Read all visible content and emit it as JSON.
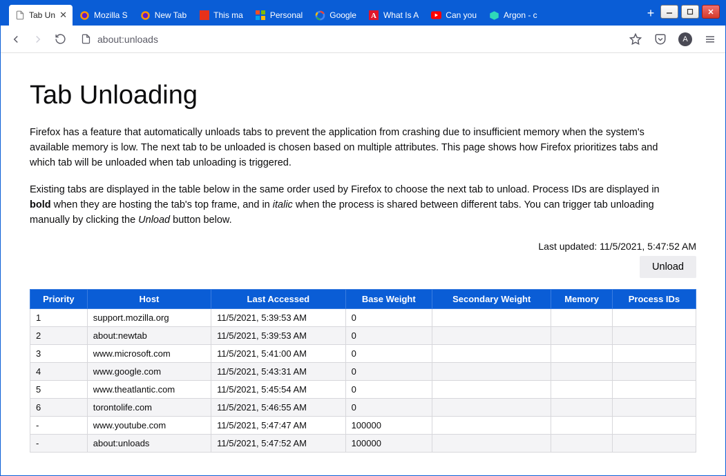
{
  "tabs": [
    {
      "label": "Tab Unloa",
      "icon": "blank",
      "active": true
    },
    {
      "label": "Mozilla S",
      "icon": "firefox"
    },
    {
      "label": "New Tab",
      "icon": "firefox"
    },
    {
      "label": "This ma",
      "icon": "microsoft-red"
    },
    {
      "label": "Personal",
      "icon": "microsoft"
    },
    {
      "label": "Google",
      "icon": "google"
    },
    {
      "label": "What Is A",
      "icon": "atlantic"
    },
    {
      "label": "Can you",
      "icon": "youtube"
    },
    {
      "label": "Argon - c",
      "icon": "argon"
    }
  ],
  "newtab_glyph": "+",
  "winctrl": {
    "min": "−",
    "max": "□",
    "close": "✕"
  },
  "url": "about:unloads",
  "avatar_letter": "A",
  "page": {
    "title": "Tab Unloading",
    "para1_a": "Firefox has a feature that automatically unloads tabs to prevent the application from crashing due to insufficient memory when the system's available memory is low. The next tab to be unloaded is chosen based on multiple attributes. This page shows how Firefox prioritizes tabs and which tab will be unloaded when tab unloading is triggered.",
    "para2_a": "Existing tabs are displayed in the table below in the same order used by Firefox to choose the next tab to unload. Process IDs are displayed in ",
    "para2_bold": "bold",
    "para2_b": " when they are hosting the tab's top frame, and in ",
    "para2_italic": "italic",
    "para2_c": " when the process is shared between different tabs. You can trigger tab unloading manually by clicking the ",
    "para2_unload_word": "Unload",
    "para2_d": " button below.",
    "last_updated_label": "Last updated: ",
    "last_updated_value": "11/5/2021, 5:47:52 AM",
    "unload_button": "Unload"
  },
  "table": {
    "headers": [
      "Priority",
      "Host",
      "Last Accessed",
      "Base Weight",
      "Secondary Weight",
      "Memory",
      "Process IDs"
    ],
    "rows": [
      {
        "priority": "1",
        "host": "support.mozilla.org",
        "last": "11/5/2021, 5:39:53 AM",
        "base": "0",
        "sec": "",
        "mem": "",
        "pid": ""
      },
      {
        "priority": "2",
        "host": "about:newtab",
        "last": "11/5/2021, 5:39:53 AM",
        "base": "0",
        "sec": "",
        "mem": "",
        "pid": ""
      },
      {
        "priority": "3",
        "host": "www.microsoft.com",
        "last": "11/5/2021, 5:41:00 AM",
        "base": "0",
        "sec": "",
        "mem": "",
        "pid": ""
      },
      {
        "priority": "4",
        "host": "www.google.com",
        "last": "11/5/2021, 5:43:31 AM",
        "base": "0",
        "sec": "",
        "mem": "",
        "pid": ""
      },
      {
        "priority": "5",
        "host": "www.theatlantic.com",
        "last": "11/5/2021, 5:45:54 AM",
        "base": "0",
        "sec": "",
        "mem": "",
        "pid": ""
      },
      {
        "priority": "6",
        "host": "torontolife.com",
        "last": "11/5/2021, 5:46:55 AM",
        "base": "0",
        "sec": "",
        "mem": "",
        "pid": ""
      },
      {
        "priority": "-",
        "host": "www.youtube.com",
        "last": "11/5/2021, 5:47:47 AM",
        "base": "100000",
        "sec": "",
        "mem": "",
        "pid": ""
      },
      {
        "priority": "-",
        "host": "about:unloads",
        "last": "11/5/2021, 5:47:52 AM",
        "base": "100000",
        "sec": "",
        "mem": "",
        "pid": ""
      }
    ]
  }
}
